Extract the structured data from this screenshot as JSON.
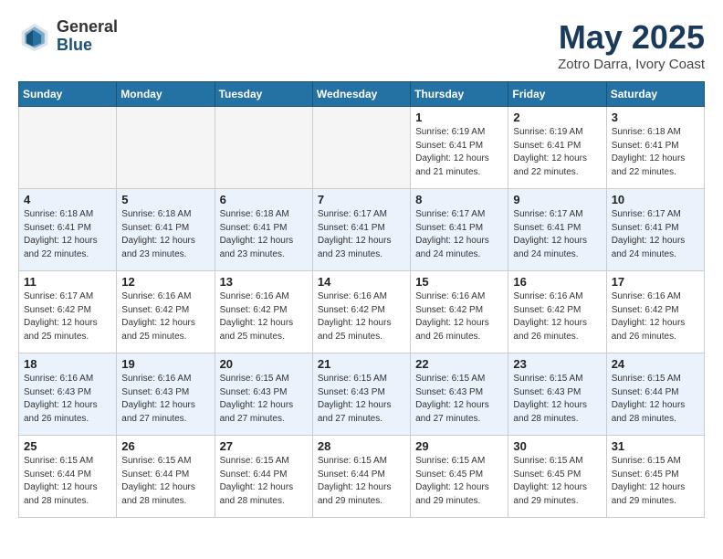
{
  "header": {
    "logo_general": "General",
    "logo_blue": "Blue",
    "title": "May 2025",
    "location": "Zotro Darra, Ivory Coast"
  },
  "weekdays": [
    "Sunday",
    "Monday",
    "Tuesday",
    "Wednesday",
    "Thursday",
    "Friday",
    "Saturday"
  ],
  "weeks": [
    [
      {
        "day": "",
        "info": ""
      },
      {
        "day": "",
        "info": ""
      },
      {
        "day": "",
        "info": ""
      },
      {
        "day": "",
        "info": ""
      },
      {
        "day": "1",
        "info": "Sunrise: 6:19 AM\nSunset: 6:41 PM\nDaylight: 12 hours\nand 21 minutes."
      },
      {
        "day": "2",
        "info": "Sunrise: 6:19 AM\nSunset: 6:41 PM\nDaylight: 12 hours\nand 22 minutes."
      },
      {
        "day": "3",
        "info": "Sunrise: 6:18 AM\nSunset: 6:41 PM\nDaylight: 12 hours\nand 22 minutes."
      }
    ],
    [
      {
        "day": "4",
        "info": "Sunrise: 6:18 AM\nSunset: 6:41 PM\nDaylight: 12 hours\nand 22 minutes."
      },
      {
        "day": "5",
        "info": "Sunrise: 6:18 AM\nSunset: 6:41 PM\nDaylight: 12 hours\nand 23 minutes."
      },
      {
        "day": "6",
        "info": "Sunrise: 6:18 AM\nSunset: 6:41 PM\nDaylight: 12 hours\nand 23 minutes."
      },
      {
        "day": "7",
        "info": "Sunrise: 6:17 AM\nSunset: 6:41 PM\nDaylight: 12 hours\nand 23 minutes."
      },
      {
        "day": "8",
        "info": "Sunrise: 6:17 AM\nSunset: 6:41 PM\nDaylight: 12 hours\nand 24 minutes."
      },
      {
        "day": "9",
        "info": "Sunrise: 6:17 AM\nSunset: 6:41 PM\nDaylight: 12 hours\nand 24 minutes."
      },
      {
        "day": "10",
        "info": "Sunrise: 6:17 AM\nSunset: 6:41 PM\nDaylight: 12 hours\nand 24 minutes."
      }
    ],
    [
      {
        "day": "11",
        "info": "Sunrise: 6:17 AM\nSunset: 6:42 PM\nDaylight: 12 hours\nand 25 minutes."
      },
      {
        "day": "12",
        "info": "Sunrise: 6:16 AM\nSunset: 6:42 PM\nDaylight: 12 hours\nand 25 minutes."
      },
      {
        "day": "13",
        "info": "Sunrise: 6:16 AM\nSunset: 6:42 PM\nDaylight: 12 hours\nand 25 minutes."
      },
      {
        "day": "14",
        "info": "Sunrise: 6:16 AM\nSunset: 6:42 PM\nDaylight: 12 hours\nand 25 minutes."
      },
      {
        "day": "15",
        "info": "Sunrise: 6:16 AM\nSunset: 6:42 PM\nDaylight: 12 hours\nand 26 minutes."
      },
      {
        "day": "16",
        "info": "Sunrise: 6:16 AM\nSunset: 6:42 PM\nDaylight: 12 hours\nand 26 minutes."
      },
      {
        "day": "17",
        "info": "Sunrise: 6:16 AM\nSunset: 6:42 PM\nDaylight: 12 hours\nand 26 minutes."
      }
    ],
    [
      {
        "day": "18",
        "info": "Sunrise: 6:16 AM\nSunset: 6:43 PM\nDaylight: 12 hours\nand 26 minutes."
      },
      {
        "day": "19",
        "info": "Sunrise: 6:16 AM\nSunset: 6:43 PM\nDaylight: 12 hours\nand 27 minutes."
      },
      {
        "day": "20",
        "info": "Sunrise: 6:15 AM\nSunset: 6:43 PM\nDaylight: 12 hours\nand 27 minutes."
      },
      {
        "day": "21",
        "info": "Sunrise: 6:15 AM\nSunset: 6:43 PM\nDaylight: 12 hours\nand 27 minutes."
      },
      {
        "day": "22",
        "info": "Sunrise: 6:15 AM\nSunset: 6:43 PM\nDaylight: 12 hours\nand 27 minutes."
      },
      {
        "day": "23",
        "info": "Sunrise: 6:15 AM\nSunset: 6:43 PM\nDaylight: 12 hours\nand 28 minutes."
      },
      {
        "day": "24",
        "info": "Sunrise: 6:15 AM\nSunset: 6:44 PM\nDaylight: 12 hours\nand 28 minutes."
      }
    ],
    [
      {
        "day": "25",
        "info": "Sunrise: 6:15 AM\nSunset: 6:44 PM\nDaylight: 12 hours\nand 28 minutes."
      },
      {
        "day": "26",
        "info": "Sunrise: 6:15 AM\nSunset: 6:44 PM\nDaylight: 12 hours\nand 28 minutes."
      },
      {
        "day": "27",
        "info": "Sunrise: 6:15 AM\nSunset: 6:44 PM\nDaylight: 12 hours\nand 28 minutes."
      },
      {
        "day": "28",
        "info": "Sunrise: 6:15 AM\nSunset: 6:44 PM\nDaylight: 12 hours\nand 29 minutes."
      },
      {
        "day": "29",
        "info": "Sunrise: 6:15 AM\nSunset: 6:45 PM\nDaylight: 12 hours\nand 29 minutes."
      },
      {
        "day": "30",
        "info": "Sunrise: 6:15 AM\nSunset: 6:45 PM\nDaylight: 12 hours\nand 29 minutes."
      },
      {
        "day": "31",
        "info": "Sunrise: 6:15 AM\nSunset: 6:45 PM\nDaylight: 12 hours\nand 29 minutes."
      }
    ]
  ]
}
